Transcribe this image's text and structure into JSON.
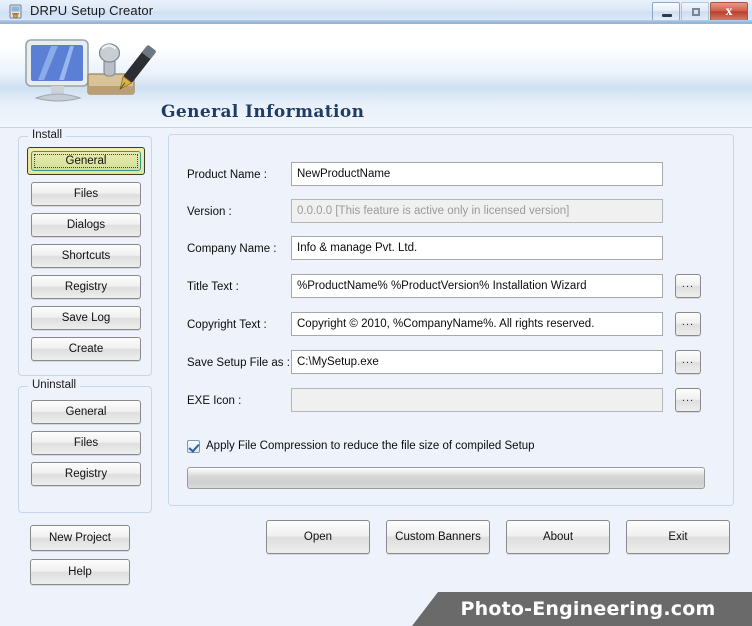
{
  "window": {
    "title": "DRPU Setup Creator",
    "app_icon": "setup-creator-icon",
    "controls": {
      "minimize": "minimize-icon",
      "maximize": "maximize-icon",
      "close": "x"
    }
  },
  "header": {
    "heading": "General Information",
    "art": "monitor-stamp-pen-illustration"
  },
  "sidebar": {
    "install": {
      "legend": "Install",
      "items": [
        {
          "label": "General",
          "selected": true
        },
        {
          "label": "Files",
          "selected": false
        },
        {
          "label": "Dialogs",
          "selected": false
        },
        {
          "label": "Shortcuts",
          "selected": false
        },
        {
          "label": "Registry",
          "selected": false
        },
        {
          "label": "Save Log",
          "selected": false
        },
        {
          "label": "Create",
          "selected": false
        }
      ]
    },
    "uninstall": {
      "legend": "Uninstall",
      "items": [
        {
          "label": "General"
        },
        {
          "label": "Files"
        },
        {
          "label": "Registry"
        }
      ]
    },
    "bottom_buttons": [
      {
        "label": "New Project"
      },
      {
        "label": "Help"
      }
    ]
  },
  "form": {
    "fields": [
      {
        "label": "Product Name :",
        "value": "NewProductName",
        "placeholder": "",
        "disabled": false,
        "browse": false
      },
      {
        "label": "Version :",
        "value": "0.0.0.0 [This feature is active only in licensed version]",
        "placeholder": "",
        "disabled": true,
        "browse": false
      },
      {
        "label": "Company Name :",
        "value": "Info & manage Pvt. Ltd.",
        "placeholder": "",
        "disabled": false,
        "browse": false
      },
      {
        "label": "Title Text :",
        "value": "%ProductName% %ProductVersion% Installation Wizard",
        "placeholder": "",
        "disabled": false,
        "browse": true
      },
      {
        "label": "Copyright Text :",
        "value": "Copyright © 2010, %CompanyName%. All rights reserved.",
        "placeholder": "",
        "disabled": false,
        "browse": true
      },
      {
        "label": "Save Setup File as :",
        "value": "C:\\MySetup.exe",
        "placeholder": "",
        "disabled": false,
        "browse": true
      },
      {
        "label": "EXE Icon :",
        "value": "",
        "placeholder": "",
        "disabled": false,
        "browse": true
      }
    ],
    "browse_label": "...",
    "compression": {
      "label": "Apply File Compression to reduce the file size of compiled Setup",
      "checked": true
    },
    "progress": {
      "value": 0
    }
  },
  "actions": [
    {
      "label": "Open"
    },
    {
      "label": "Custom Banners"
    },
    {
      "label": "About"
    },
    {
      "label": "Exit"
    }
  ],
  "watermark": {
    "text": "Photo-Engineering.com"
  },
  "colors": {
    "accent": "#1f3d63",
    "body_bg": "#eef2fa",
    "selected_btn": "#e4e49a",
    "close_btn": "#b63f2c",
    "watermark_bg": "#6a6a6a"
  }
}
